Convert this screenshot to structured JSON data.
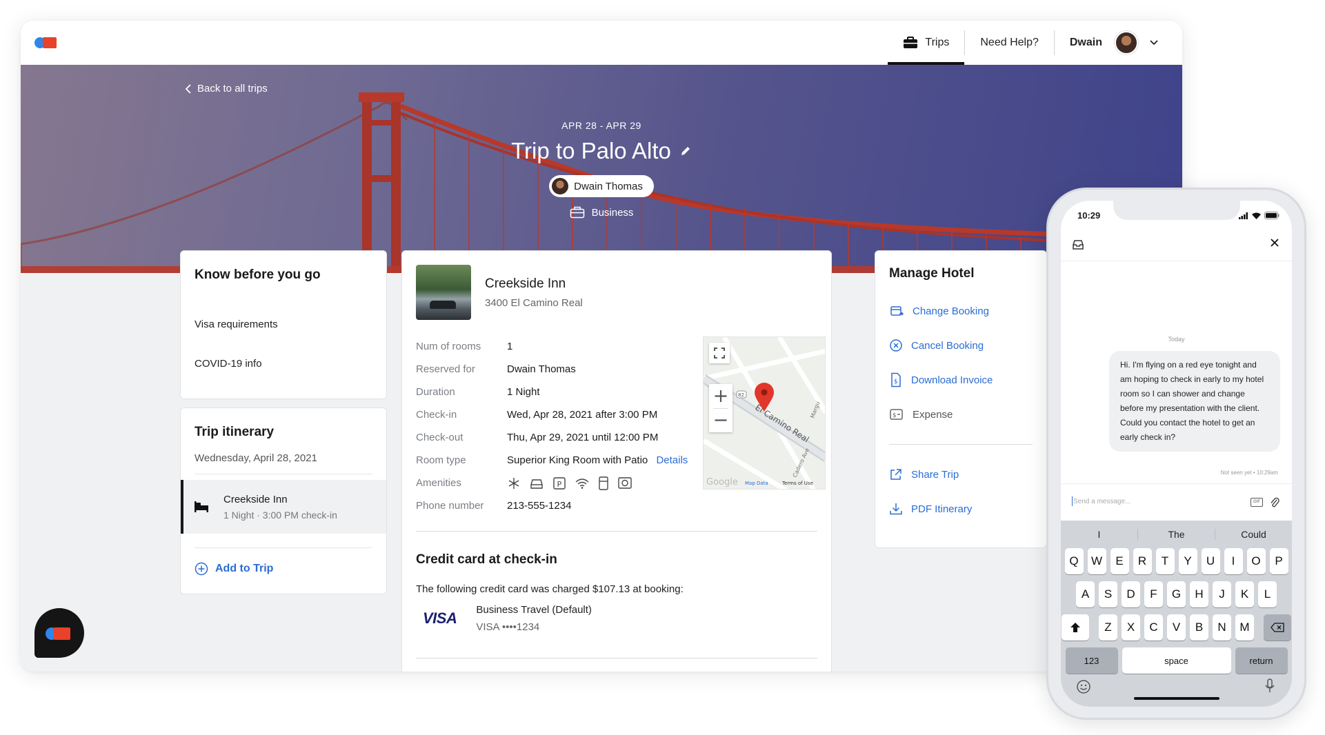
{
  "nav": {
    "trips": "Trips",
    "help": "Need Help?",
    "user": "Dwain"
  },
  "hero": {
    "back": "Back to all trips",
    "dates": "APR 28 - APR 29",
    "title": "Trip to Palo Alto",
    "traveler": "Dwain Thomas",
    "type": "Business"
  },
  "know_before": {
    "title": "Know before you go",
    "items": [
      "Visa requirements",
      "COVID-19 info"
    ]
  },
  "itinerary": {
    "title": "Trip itinerary",
    "date": "Wednesday, April 28, 2021",
    "entry_name": "Creekside Inn",
    "entry_sub": "1 Night · 3:00 PM check-in",
    "add": "Add to Trip"
  },
  "hotel": {
    "name": "Creekside Inn",
    "address": "3400 El Camino Real",
    "fields": [
      {
        "k": "Num of rooms",
        "v": "1"
      },
      {
        "k": "Reserved for",
        "v": "Dwain Thomas"
      },
      {
        "k": "Duration",
        "v": "1 Night"
      },
      {
        "k": "Check-in",
        "v": "Wed, Apr 28, 2021 after 3:00 PM"
      },
      {
        "k": "Check-out",
        "v": "Thu, Apr 29, 2021 until 12:00 PM"
      }
    ],
    "room_type_label": "Room type",
    "room_type": "Superior King Room with Patio",
    "details_link": "Details",
    "amenities_label": "Amenities",
    "phone_label": "Phone number",
    "phone": "213-555-1234",
    "map": {
      "street": "El Camino Real",
      "street2": "Margu",
      "street3": "Cadero Ave",
      "route": "82",
      "google": "Google",
      "map_data": "Map Data",
      "terms": "Terms of Use"
    }
  },
  "credit": {
    "title": "Credit card at check-in",
    "text": "The following credit card was charged $107.13 at booking:",
    "brand": "VISA",
    "name": "Business Travel (Default)",
    "number": "VISA ••••1234"
  },
  "manage": {
    "title": "Manage Hotel",
    "items": [
      "Change Booking",
      "Cancel Booking",
      "Download Invoice",
      "Expense"
    ],
    "items2": [
      "Share Trip",
      "PDF Itinerary"
    ]
  },
  "phone": {
    "time": "10:29",
    "today": "Today",
    "message": "Hi. I'm flying on a red eye tonight and am hoping to check in early to my hotel room so I can shower and change before my presentation with the client. Could you contact the hotel to get an early check in?",
    "not_seen": "Not seen yet • 10:29am",
    "placeholder": "Send a message...",
    "gif": "GIF",
    "suggestions": [
      "I",
      "The",
      "Could"
    ],
    "row1": [
      "Q",
      "W",
      "E",
      "R",
      "T",
      "Y",
      "U",
      "I",
      "O",
      "P"
    ],
    "row2": [
      "A",
      "S",
      "D",
      "F",
      "G",
      "H",
      "J",
      "K",
      "L"
    ],
    "row3": [
      "Z",
      "X",
      "C",
      "V",
      "B",
      "N",
      "M"
    ],
    "num": "123",
    "space": "space",
    "ret": "return"
  },
  "colors": {
    "link": "#2b6cd4",
    "brand_blue": "#2f86e8",
    "brand_red": "#e8422a",
    "bridge": "#b8382a"
  }
}
